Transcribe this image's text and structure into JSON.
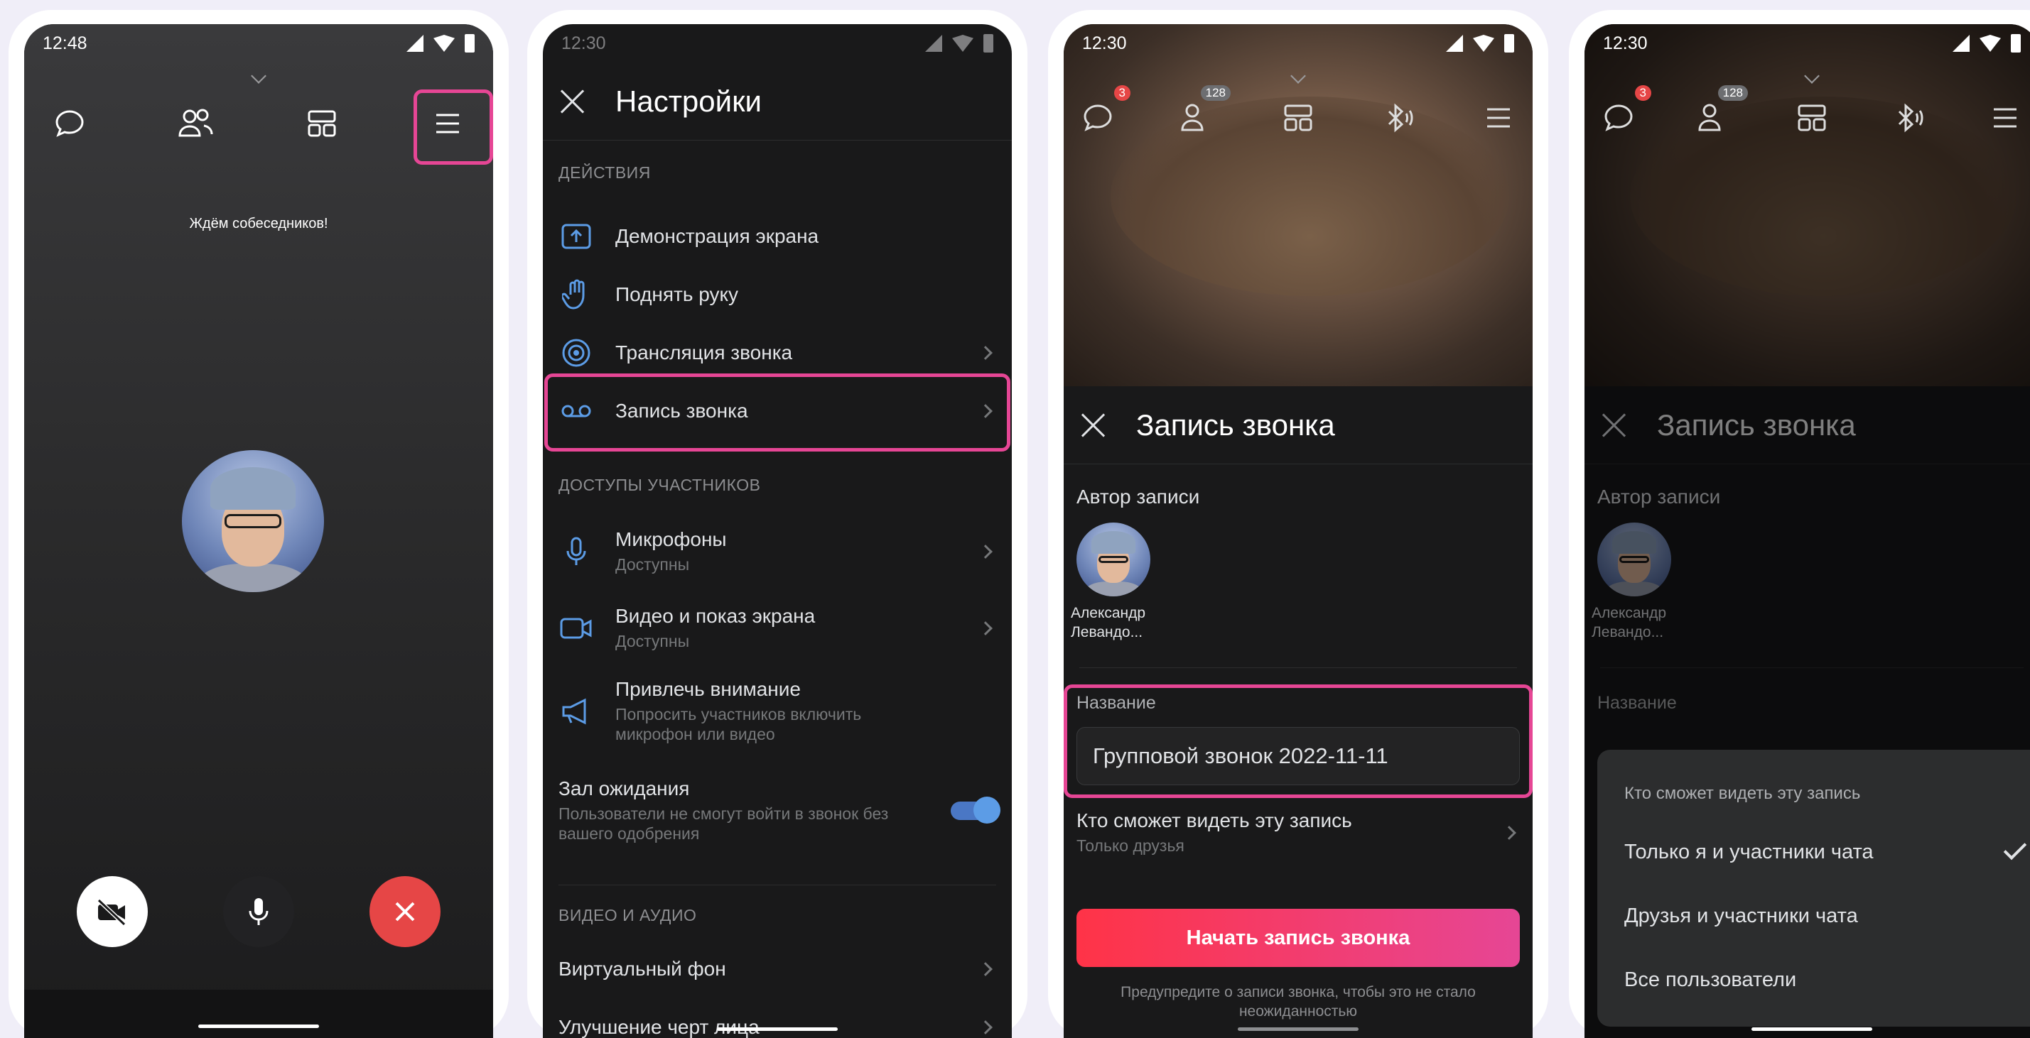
{
  "phone1": {
    "time": "12:48",
    "waiting_text": "Ждём собеседников!"
  },
  "phone2": {
    "time": "12:30",
    "title": "Настройки",
    "section_actions": "ДЕЙСТВИЯ",
    "items_actions": [
      {
        "label": "Демонстрация экрана"
      },
      {
        "label": "Поднять руку"
      },
      {
        "label": "Трансляция звонка"
      },
      {
        "label": "Запись звонка"
      }
    ],
    "section_participants": "ДОСТУПЫ УЧАСТНИКОВ",
    "items_participants": [
      {
        "label": "Микрофоны",
        "sub": "Доступны"
      },
      {
        "label": "Видео и показ экрана",
        "sub": "Доступны"
      },
      {
        "label": "Привлечь внимание",
        "sub": "Попросить участников включить микрофон или видео"
      },
      {
        "label": "Зал ожидания",
        "sub": "Пользователи не смогут войти в звонок без вашего одобрения",
        "toggle": true
      }
    ],
    "section_video": "ВИДЕО И АУДИО",
    "items_video": [
      {
        "label": "Виртуальный фон"
      },
      {
        "label": "Улучшение черт лица"
      }
    ]
  },
  "phone3": {
    "time": "12:30",
    "badge_chat": "3",
    "badge_people": "128",
    "title": "Запись звонка",
    "author_label": "Автор записи",
    "author_name_1": "Александр",
    "author_name_2": "Левандо...",
    "name_label": "Название",
    "name_value": "Групповой звонок 2022-11-11",
    "who_label": "Кто сможет видеть эту запись",
    "who_value": "Только друзья",
    "start_button": "Начать запись звонка",
    "note": "Предупредите о записи звонка, чтобы это не стало неожиданностью"
  },
  "phone4": {
    "time": "12:30",
    "badge_chat": "3",
    "badge_people": "128",
    "title": "Запись звонка",
    "author_label": "Автор записи",
    "author_name_1": "Александр",
    "author_name_2": "Левандо...",
    "name_label": "Название",
    "popup": {
      "title": "Кто сможет видеть эту запись",
      "options": [
        {
          "label": "Только я и участники чата",
          "selected": true
        },
        {
          "label": "Друзья и участники чата",
          "selected": false
        },
        {
          "label": "Все пользователи",
          "selected": false
        }
      ]
    }
  },
  "colors": {
    "accent_pink": "#e64695",
    "accent_blue": "#5c9ce6",
    "danger_red": "#e64646",
    "background": "#19191a"
  }
}
